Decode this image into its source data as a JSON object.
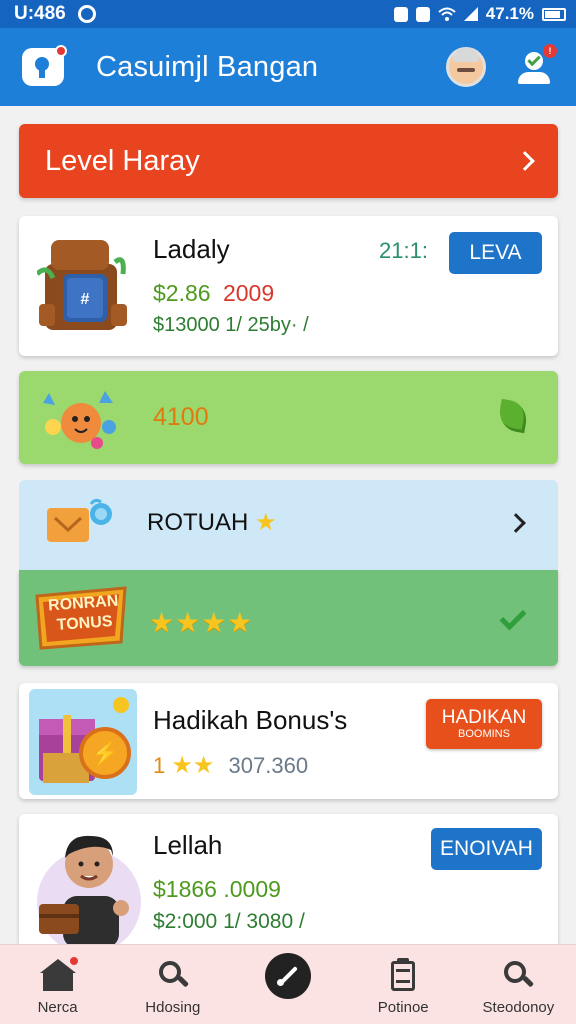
{
  "status_bar": {
    "time": "U:486",
    "battery": "47.1%"
  },
  "app_bar": {
    "title": "Casuimjl Bangan"
  },
  "level_banner": {
    "label": "Level Haray"
  },
  "items": [
    {
      "title": "Ladaly",
      "time": "21:1:",
      "button": "LEVA",
      "price": "$2.86",
      "price_alt": "2009",
      "sub": "$13000 1/ 25by· /"
    },
    {
      "value": "4100"
    },
    {
      "title": "ROTUAH"
    },
    {
      "badge_top": "RONRAN",
      "badge_bottom": "TONUS",
      "stars": "★★★★"
    },
    {
      "title": "Hadikah Bonus's",
      "button_top": "HADIKAN",
      "button_bottom": "BOOMINS",
      "rating_num": "1",
      "stars": "★★",
      "count": "307.360"
    },
    {
      "title": "Lellah",
      "button": "ENOIVAH",
      "price": "$1866 .0009",
      "sub": "$2:000 1/ 3080 /"
    }
  ],
  "bottom_nav": [
    {
      "label": "Nerca",
      "icon": "home-icon"
    },
    {
      "label": "Hdosing",
      "icon": "search-icon"
    },
    {
      "label": "",
      "icon": "pen-icon"
    },
    {
      "label": "Potinoe",
      "icon": "clipboard-icon"
    },
    {
      "label": "Steodonoy",
      "icon": "search-icon"
    }
  ],
  "colors": {
    "primary": "#1e7fd8",
    "level_banner": "#e8441f",
    "green_card": "#9bd96e",
    "blue_card": "#cfe8f8",
    "green_card_dark": "#72c17a",
    "button_blue": "#1e74c9",
    "button_orange": "#e8501b"
  }
}
